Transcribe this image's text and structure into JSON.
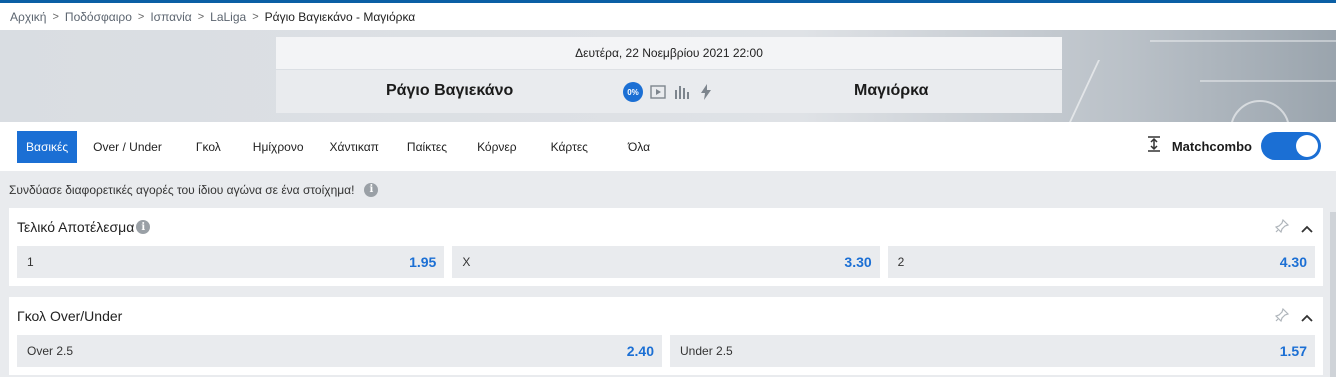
{
  "breadcrumb": [
    "Αρχική",
    "Ποδόσφαιρο",
    "Ισπανία",
    "LaLiga",
    "Ράγιο Βαγιεκάνο - Μαγιόρκα"
  ],
  "match": {
    "datetime": "Δευτέρα, 22 Νοεμβρίου 2021 22:00",
    "home": "Ράγιο Βαγιεκάνο",
    "away": "Μαγιόρκα",
    "badge": "0%",
    "icons": [
      "play-icon",
      "stats-icon",
      "lightning-icon"
    ]
  },
  "tabs": [
    "Βασικές",
    "Over / Under",
    "Γκολ",
    "Ημίχρονο",
    "Χάντικαπ",
    "Παίκτες",
    "Κόρνερ",
    "Κάρτες",
    "Όλα"
  ],
  "matchcombo": {
    "label": "Matchcombo",
    "enabled": true
  },
  "promo": {
    "text": "Συνδύασε διαφορετικές αγορές του ίδιου αγώνα σε ένα στοίχημα!"
  },
  "markets": [
    {
      "title": "Τελικό Αποτέλεσμα",
      "odds": [
        {
          "label": "1",
          "value": "1.95"
        },
        {
          "label": "X",
          "value": "3.30"
        },
        {
          "label": "2",
          "value": "4.30"
        }
      ]
    },
    {
      "title": "Γκολ Over/Under",
      "odds": [
        {
          "label": "Over 2.5",
          "value": "2.40"
        },
        {
          "label": "Under 2.5",
          "value": "1.57"
        }
      ]
    }
  ],
  "colors": {
    "accent": "#1b6fd4",
    "background": "#e9ebee",
    "odds_value": "#1b6fd4"
  }
}
